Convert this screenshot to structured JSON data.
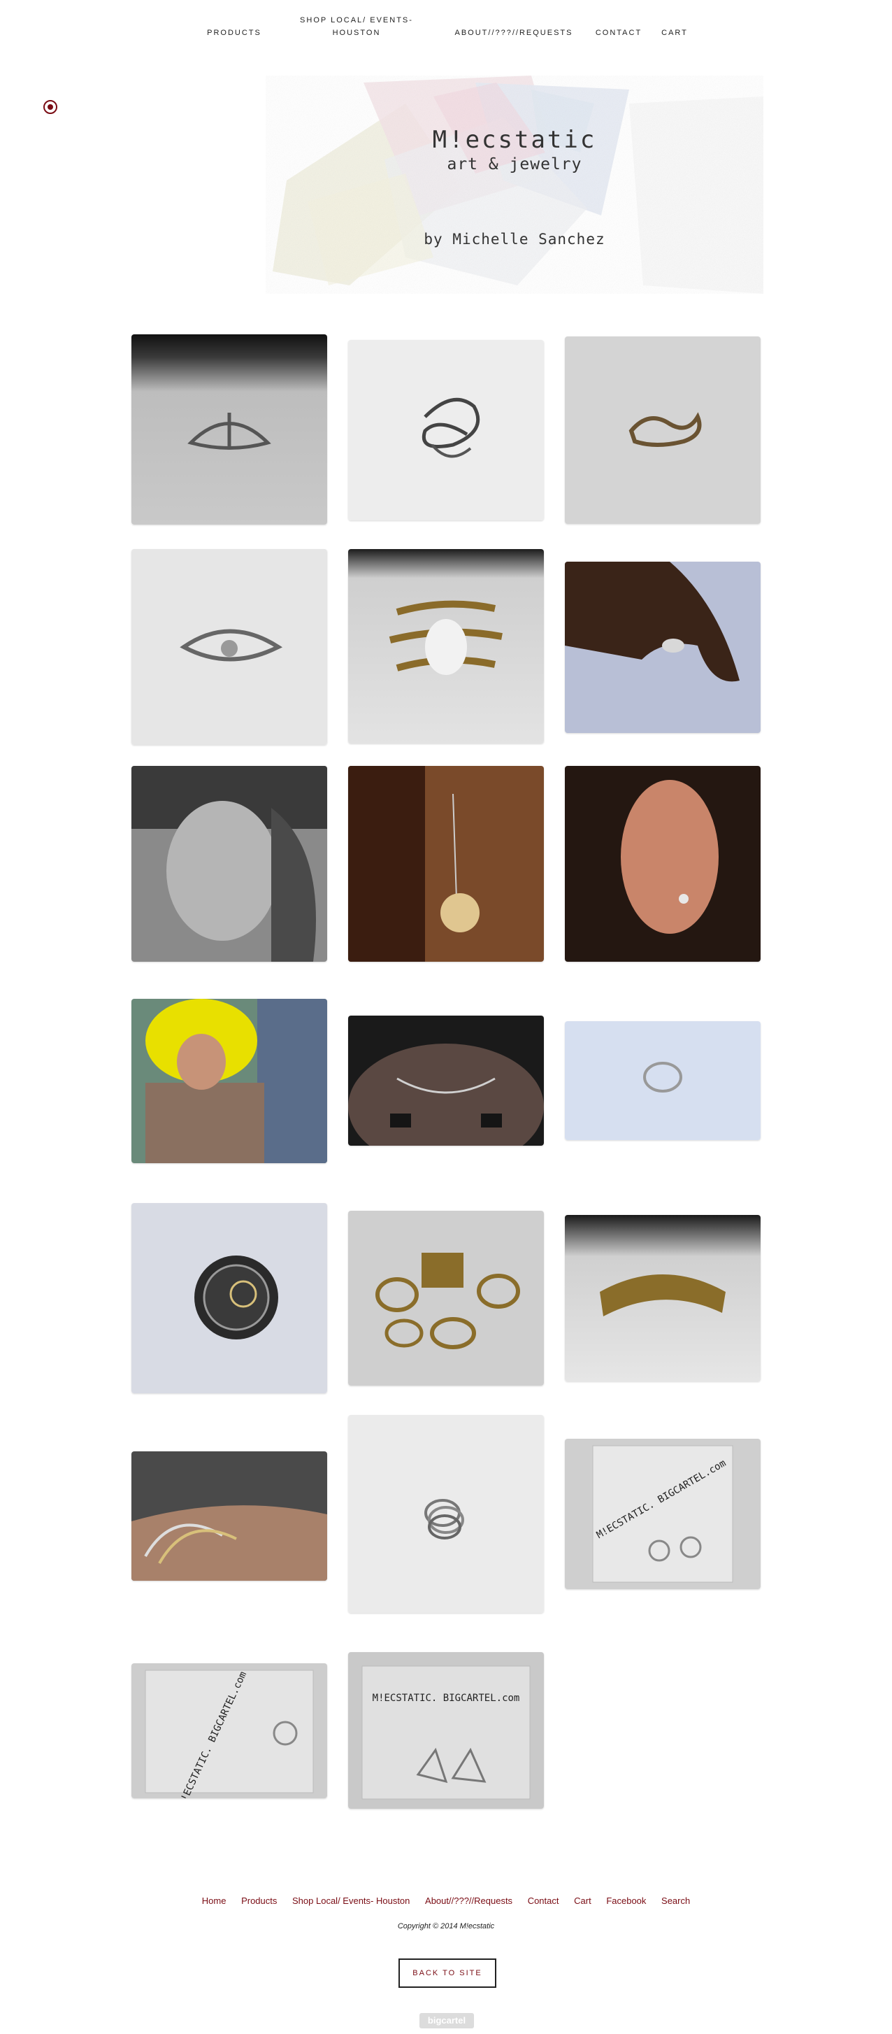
{
  "nav": {
    "products": "PRODUCTS",
    "shop_local": "SHOP LOCAL/ EVENTS- HOUSTON",
    "about": "ABOUT//???//REQUESTS",
    "contact": "CONTACT",
    "cart": "CART"
  },
  "banner": {
    "title": "M!ecstatic",
    "subtitle": "art & jewelry",
    "byline": "by Michelle Sanchez"
  },
  "products": [
    {
      "subject": "silver triangle ring"
    },
    {
      "subject": "silver swirl ring"
    },
    {
      "subject": "bronze knot ring"
    },
    {
      "subject": "silver eye ring"
    },
    {
      "subject": "gold wrap ring with stone"
    },
    {
      "subject": "ring on hand"
    },
    {
      "subject": "portrait with nose ring"
    },
    {
      "subject": "skull charm earring"
    },
    {
      "subject": "stud earring"
    },
    {
      "subject": "woman with yellow hair and necklace"
    },
    {
      "subject": "silver collar necklace"
    },
    {
      "subject": "silver ring on blue"
    },
    {
      "subject": "rings in tin"
    },
    {
      "subject": "gold ring set"
    },
    {
      "subject": "gold cuff bracelet"
    },
    {
      "subject": "stacked bangles on wrist"
    },
    {
      "subject": "stacked silver rings"
    },
    {
      "subject": "packaged hoop earrings",
      "label": "M!ECSTATIC. BIGCARTEL.com"
    },
    {
      "subject": "packaged ring",
      "label": "M!ECSTATIC. BIGCARTEL.com"
    },
    {
      "subject": "packaged triangle earrings",
      "label": "M!ECSTATIC. BIGCARTEL.com"
    }
  ],
  "footer": {
    "links": [
      "Home",
      "Products",
      "Shop Local/ Events- Houston",
      "About//???//Requests",
      "Contact",
      "Cart",
      "Facebook",
      "Search"
    ],
    "copyright": "Copyright © 2014 M!ecstatic",
    "back_to_site": "BACK TO SITE",
    "powered_by": "bigcartel"
  },
  "colors": {
    "accent": "#7a0c14",
    "text": "#222222",
    "background": "#ffffff"
  },
  "icons": {
    "back": "back-circle-icon"
  }
}
